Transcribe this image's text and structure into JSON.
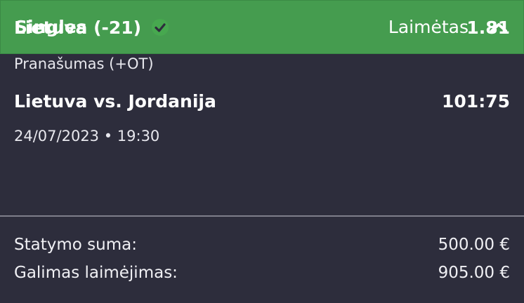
{
  "header": {
    "title": "Singles",
    "status": "Laimėtas",
    "toggle_icon": "chevron-up-icon"
  },
  "selection": {
    "name": "Lietuva (-21)",
    "result_icon": "check-circle-icon",
    "odds": "1.81",
    "market": "Pranašumas (+OT)",
    "event": "Lietuva vs. Jordanija",
    "score": "101:75",
    "datetime": "24/07/2023 • 19:30"
  },
  "summary": {
    "stake_label": "Statymo suma:",
    "stake_value": "500.00 €",
    "payout_label": "Galimas laimėjimas:",
    "payout_value": "905.00 €"
  },
  "colors": {
    "header_bg": "#459c4f",
    "card_bg": "#2d2d3c",
    "check_green": "#47a84f"
  }
}
